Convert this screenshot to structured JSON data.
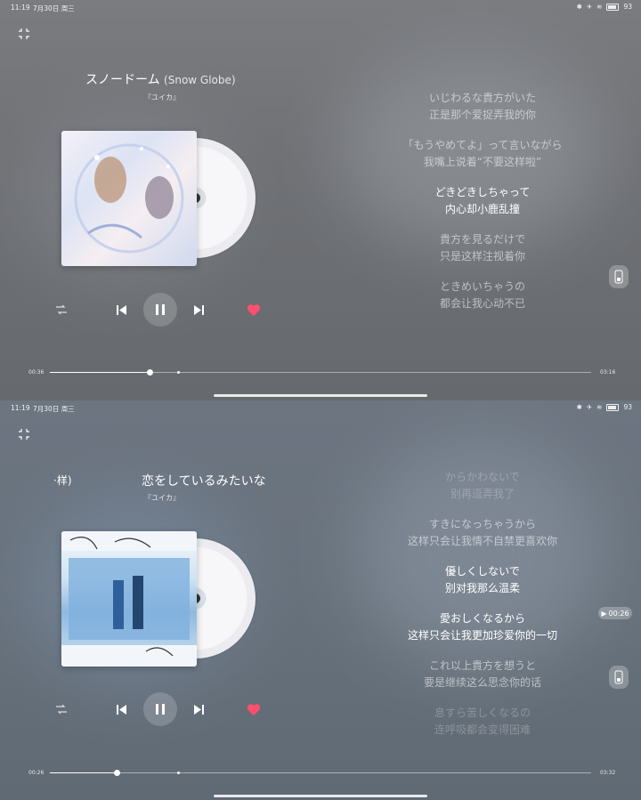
{
  "status_bar": {
    "time": "11:19",
    "date": "7月30日 周三",
    "battery": "93"
  },
  "screen1": {
    "song_title": "スノードーム",
    "song_subtitle": "(Snow Globe)",
    "artist": "『ユイカ』",
    "elapsed": "00:36",
    "duration": "03:16",
    "progress": 0.184,
    "lyrics": [
      {
        "jp": "いじわるな貴方がいた",
        "cn": "正是那个爱捉弄我的你",
        "state": "normal"
      },
      {
        "jp": "「もうやめてよ」って言いながら",
        "cn": "我嘴上说着“不要这样啦”",
        "state": "normal"
      },
      {
        "jp": "どきどきしちゃって",
        "cn": "内心却小鹿乱撞",
        "state": "active"
      },
      {
        "jp": "貴方を見るだけで",
        "cn": "只是这样注视着你",
        "state": "normal"
      },
      {
        "jp": "ときめいちゃうの",
        "cn": "都会让我心动不已",
        "state": "normal"
      }
    ]
  },
  "screen2": {
    "song_title": "恋をしているみたいな",
    "title_prev_fragment": "·样)",
    "artist": "『ユイカ』",
    "elapsed": "00:26",
    "duration": "03:32",
    "progress": 0.123,
    "time_badge": "00:26",
    "lyrics": [
      {
        "jp": "からかわないで",
        "cn": "别再逗弄我了",
        "state": "fade"
      },
      {
        "jp": "すきになっちゃうから",
        "cn": "这样只会让我情不自禁更喜欢你",
        "state": "normal"
      },
      {
        "jp": "優しくしないで",
        "cn": "别对我那么温柔",
        "state": "active"
      },
      {
        "jp": "愛おしくなるから",
        "cn": "这样只会让我更加珍爱你的一切",
        "state": "active"
      },
      {
        "jp": "これ以上貴方を想うと",
        "cn": "要是继续这么思念你的话",
        "state": "normal"
      },
      {
        "jp": "息すら苦しくなるの",
        "cn": "连呼吸都会变得困难",
        "state": "fade"
      }
    ]
  },
  "colors": {
    "accent_heart": "#ff4f6d"
  },
  "icons": [
    "collapse-icon",
    "shuffle-icon",
    "previous-icon",
    "pause-icon",
    "next-icon",
    "heart-icon",
    "lyric-mode-icon"
  ]
}
